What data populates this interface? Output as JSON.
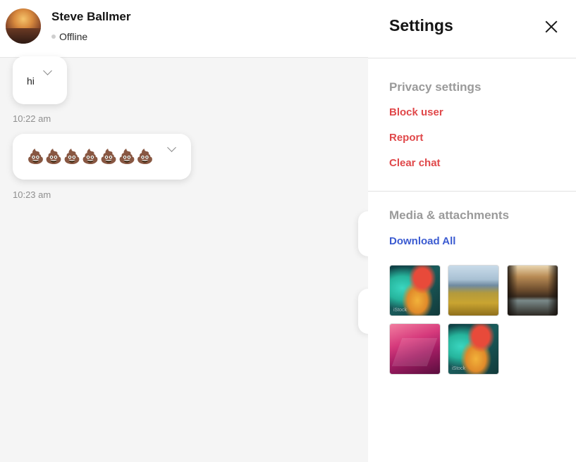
{
  "header": {
    "contact_name": "Steve Ballmer",
    "status": "Offline"
  },
  "messages": [
    {
      "text": "hi",
      "time": "10:22 am"
    },
    {
      "text": "💩💩💩💩💩💩💩",
      "time": "10:23 am"
    }
  ],
  "settings": {
    "title": "Settings",
    "privacy": {
      "title": "Privacy settings",
      "block_user": "Block user",
      "report": "Report",
      "clear_chat": "Clear chat"
    },
    "media": {
      "title": "Media & attachments",
      "download_all": "Download All",
      "thumbnail_watermark": "iStock"
    }
  },
  "colors": {
    "danger": "#e0484a",
    "link": "#3b5bd1",
    "muted": "#9a9a9a",
    "status_dot": "#cfcfcf"
  }
}
